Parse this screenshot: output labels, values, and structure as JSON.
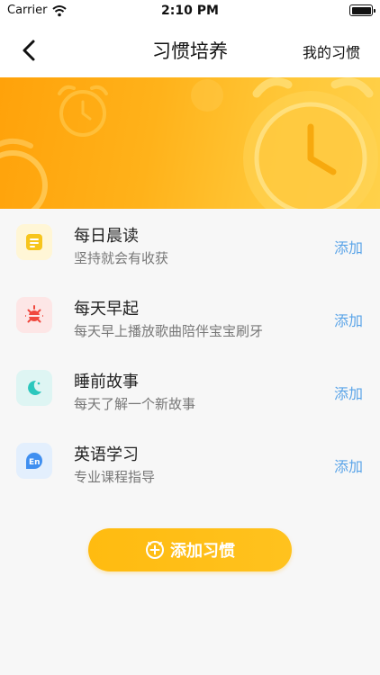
{
  "status_bar": {
    "carrier": "Carrier",
    "time": "2:10 PM"
  },
  "nav": {
    "title": "习惯培养",
    "right_label": "我的习惯"
  },
  "habits": [
    {
      "title": "每日晨读",
      "desc": "坚持就会有收获",
      "action": "添加",
      "icon": "note-icon",
      "icon_color": "#f7c51c",
      "bg": "#fff6d6"
    },
    {
      "title": "每天早起",
      "desc": "每天早上播放歌曲陪伴宝宝刷牙",
      "action": "添加",
      "icon": "sunrise-icon",
      "icon_color": "#f0483e",
      "bg": "#fde6e6"
    },
    {
      "title": "睡前故事",
      "desc": "每天了解一个新故事",
      "action": "添加",
      "icon": "moon-icon",
      "icon_color": "#2cc7bd",
      "bg": "#def5f3"
    },
    {
      "title": "英语学习",
      "desc": "专业课程指导",
      "action": "添加",
      "icon": "english-icon",
      "icon_color": "#3f8ff0",
      "bg": "#e3effd"
    }
  ],
  "add_button": {
    "label": "添加习惯"
  },
  "colors": {
    "accent": "#ffbb10",
    "link": "#5aa4e8"
  }
}
